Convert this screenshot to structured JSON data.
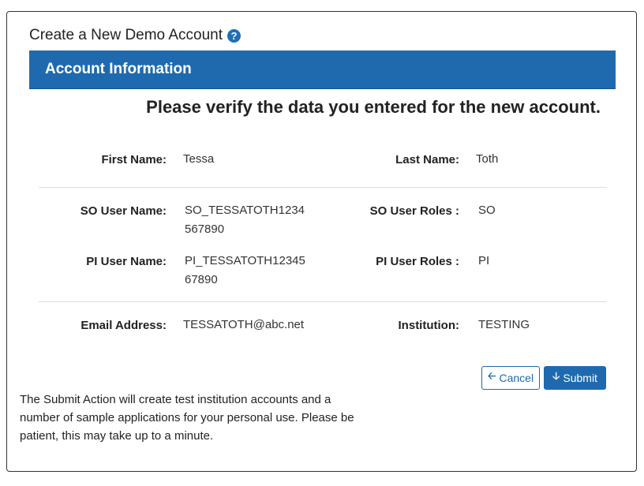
{
  "page": {
    "title": "Create a New Demo Account",
    "help_icon": "?"
  },
  "panel": {
    "header": "Account Information",
    "verify_message": "Please verify the data you entered for the new account."
  },
  "fields": {
    "first_name": {
      "label": "First Name:",
      "value": "Tessa"
    },
    "last_name": {
      "label": "Last Name:",
      "value": "Toth"
    },
    "so_user_name": {
      "label": "SO User Name:",
      "value": "SO_TESSATOTH1234567890"
    },
    "so_user_roles": {
      "label": "SO User Roles :",
      "value": "SO"
    },
    "pi_user_name": {
      "label": "PI User Name:",
      "value": "PI_TESSATOTH1234567890"
    },
    "pi_user_roles": {
      "label": "PI User Roles :",
      "value": "PI"
    },
    "email": {
      "label": "Email Address:",
      "value": "TESSATOTH@abc.net"
    },
    "institution": {
      "label": "Institution:",
      "value": "TESTING"
    }
  },
  "buttons": {
    "cancel": "Cancel",
    "cancel_icon": "arrow-left-icon",
    "submit": "Submit",
    "submit_icon": "arrow-down-icon"
  },
  "note": "The Submit Action will create test institution accounts and a number of sample applications for your personal use. Please be patient, this may take up to a minute.",
  "colors": {
    "primary": "#1f6aaf"
  }
}
